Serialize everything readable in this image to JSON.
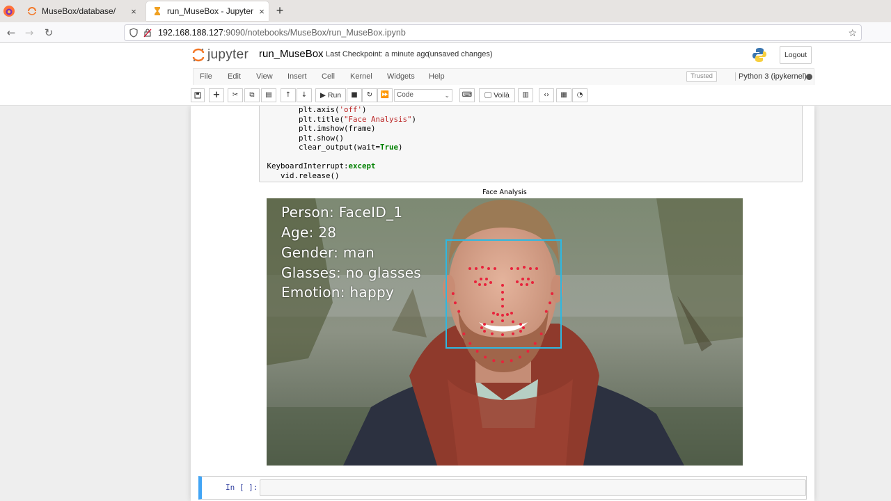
{
  "browser": {
    "tabs": [
      {
        "label": "MuseBox/database/",
        "close": "×"
      },
      {
        "label": "run_MuseBox - Jupyter N",
        "close": "×"
      }
    ],
    "new_tab": "+",
    "url_host": "192.168.188.127",
    "url_path": ":9090/notebooks/MuseBox/run_MuseBox.ipynb"
  },
  "jupyter": {
    "logo_text": "jupyter",
    "notebook_name": "run_MuseBox",
    "checkpoint": "Last Checkpoint: a minute ago",
    "unsaved": "(unsaved changes)",
    "logout": "Logout",
    "menu": [
      "File",
      "Edit",
      "View",
      "Insert",
      "Cell",
      "Kernel",
      "Widgets",
      "Help"
    ],
    "trusted": "Trusted",
    "kernel": "Python 3 (ipykernel)",
    "toolbar": {
      "run": "Run",
      "cell_type": "Code",
      "voila": "Voilà"
    }
  },
  "code_lines": [
    {
      "pre": "        plt.axis(",
      "str": "'off'",
      "post": ")"
    },
    {
      "pre": "        plt.title(",
      "str": "\"Face Analysis\"",
      "post": ")"
    },
    {
      "pre": "        plt.imshow(frame)",
      "str": "",
      "post": ""
    },
    {
      "pre": "        plt.show()",
      "str": "",
      "post": ""
    },
    {
      "pre": "        clear_output(wait=",
      "kw": "True",
      "post": ")"
    },
    {
      "pre": "",
      "str": "",
      "post": ""
    },
    {
      "kw": "except",
      "pre": " KeyboardInterrupt:",
      "post": ""
    },
    {
      "pre": "    vid.release()",
      "str": "",
      "post": ""
    }
  ],
  "output": {
    "figure_title": "Face Analysis",
    "overlay": [
      "Person: FaceID_1",
      "Age: 28",
      "Gender: man",
      "Glasses: no glasses",
      "Emotion: happy"
    ],
    "box_color": "#2fb8e0",
    "landmark_color": "#e8233c"
  },
  "input_prompt": "In [ ]:"
}
